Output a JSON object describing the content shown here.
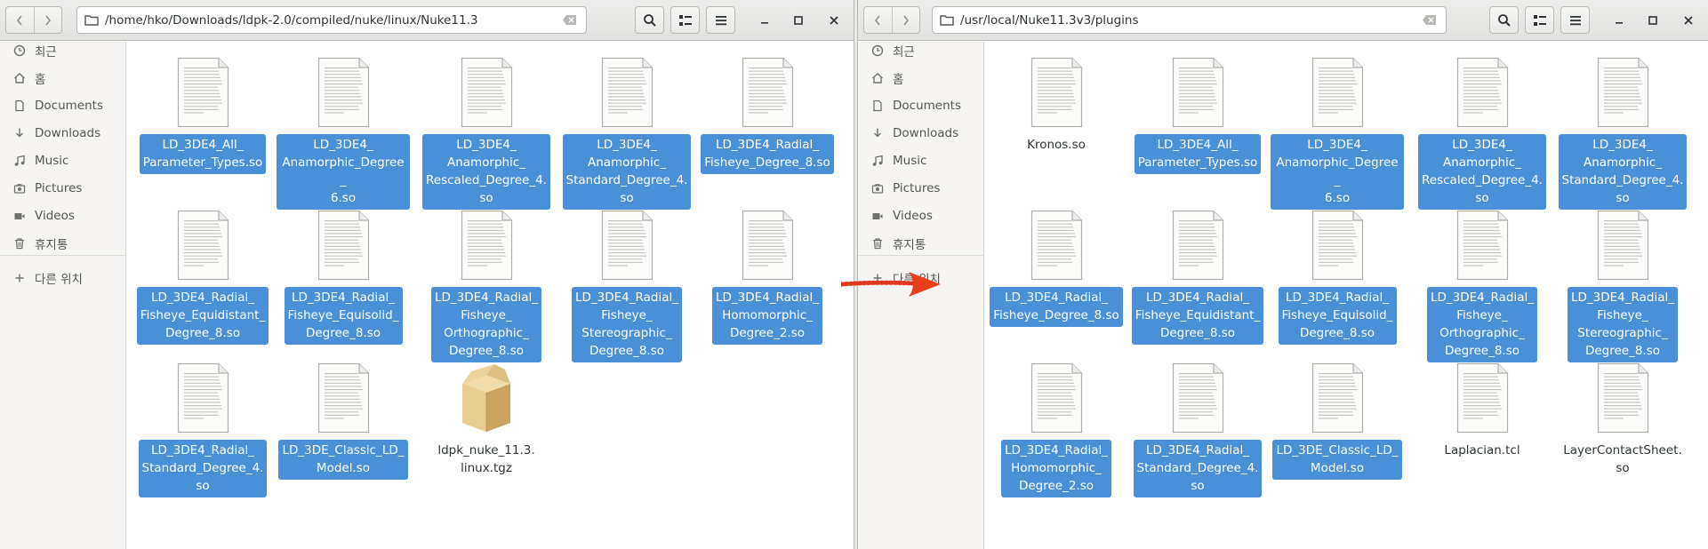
{
  "left": {
    "path": "/home/hko/Downloads/ldpk-2.0/compiled/nuke/linux/Nuke11.3",
    "files": [
      {
        "name": "LD_3DE4_All_\nParameter_Types.so",
        "selected": true,
        "icon": "document-icon"
      },
      {
        "name": "LD_3DE4_\nAnamorphic_Degree_\n6.so",
        "selected": true,
        "icon": "document-icon"
      },
      {
        "name": "LD_3DE4_\nAnamorphic_\nRescaled_Degree_4.\nso",
        "selected": true,
        "icon": "document-icon"
      },
      {
        "name": "LD_3DE4_\nAnamorphic_\nStandard_Degree_4.\nso",
        "selected": true,
        "icon": "document-icon"
      },
      {
        "name": "LD_3DE4_Radial_\nFisheye_Degree_8.so",
        "selected": true,
        "icon": "document-icon"
      },
      {
        "name": "LD_3DE4_Radial_\nFisheye_Equidistant_\nDegree_8.so",
        "selected": true,
        "icon": "document-icon"
      },
      {
        "name": "LD_3DE4_Radial_\nFisheye_Equisolid_\nDegree_8.so",
        "selected": true,
        "icon": "document-icon"
      },
      {
        "name": "LD_3DE4_Radial_\nFisheye_\nOrthographic_\nDegree_8.so",
        "selected": true,
        "icon": "document-icon"
      },
      {
        "name": "LD_3DE4_Radial_\nFisheye_\nStereographic_\nDegree_8.so",
        "selected": true,
        "icon": "document-icon"
      },
      {
        "name": "LD_3DE4_Radial_\nHomomorphic_\nDegree_2.so",
        "selected": true,
        "icon": "document-icon"
      },
      {
        "name": "LD_3DE4_Radial_\nStandard_Degree_4.\nso",
        "selected": true,
        "icon": "document-icon"
      },
      {
        "name": "LD_3DE_Classic_LD_\nModel.so",
        "selected": true,
        "icon": "document-icon"
      },
      {
        "name": "ldpk_nuke_11.3.\nlinux.tgz",
        "selected": false,
        "icon": "package-icon"
      }
    ]
  },
  "right": {
    "path": "/usr/local/Nuke11.3v3/plugins",
    "files": [
      {
        "name": "Kronos.so",
        "selected": false,
        "icon": "document-icon"
      },
      {
        "name": "LD_3DE4_All_\nParameter_Types.so",
        "selected": true,
        "icon": "document-icon"
      },
      {
        "name": "LD_3DE4_\nAnamorphic_Degree_\n6.so",
        "selected": true,
        "icon": "document-icon"
      },
      {
        "name": "LD_3DE4_\nAnamorphic_\nRescaled_Degree_4.\nso",
        "selected": true,
        "icon": "document-icon"
      },
      {
        "name": "LD_3DE4_\nAnamorphic_\nStandard_Degree_4.\nso",
        "selected": true,
        "icon": "document-icon"
      },
      {
        "name": "LD_3DE4_Radial_\nFisheye_Degree_8.so",
        "selected": true,
        "icon": "document-icon"
      },
      {
        "name": "LD_3DE4_Radial_\nFisheye_Equidistant_\nDegree_8.so",
        "selected": true,
        "icon": "document-icon"
      },
      {
        "name": "LD_3DE4_Radial_\nFisheye_Equisolid_\nDegree_8.so",
        "selected": true,
        "icon": "document-icon"
      },
      {
        "name": "LD_3DE4_Radial_\nFisheye_\nOrthographic_\nDegree_8.so",
        "selected": true,
        "icon": "document-icon"
      },
      {
        "name": "LD_3DE4_Radial_\nFisheye_\nStereographic_\nDegree_8.so",
        "selected": true,
        "icon": "document-icon"
      },
      {
        "name": "LD_3DE4_Radial_\nHomomorphic_\nDegree_2.so",
        "selected": true,
        "icon": "document-icon"
      },
      {
        "name": "LD_3DE4_Radial_\nStandard_Degree_4.\nso",
        "selected": true,
        "icon": "document-icon"
      },
      {
        "name": "LD_3DE_Classic_LD_\nModel.so",
        "selected": true,
        "icon": "document-icon"
      },
      {
        "name": "Laplacian.tcl",
        "selected": false,
        "icon": "document-icon"
      },
      {
        "name": "LayerContactSheet.\nso",
        "selected": false,
        "icon": "document-icon"
      }
    ]
  },
  "sidebar": [
    {
      "label": "최근",
      "icon": "clock-icon"
    },
    {
      "label": "홈",
      "icon": "home-icon"
    },
    {
      "label": "Documents",
      "icon": "document-folder-icon"
    },
    {
      "label": "Downloads",
      "icon": "download-icon"
    },
    {
      "label": "Music",
      "icon": "music-icon"
    },
    {
      "label": "Pictures",
      "icon": "camera-icon"
    },
    {
      "label": "Videos",
      "icon": "video-icon"
    },
    {
      "label": "휴지통",
      "icon": "trash-icon"
    },
    {
      "label": "다른 위치",
      "icon": "plus-icon"
    }
  ],
  "colors": {
    "selection": "#4a90d9",
    "arrow": "#e03a1e"
  }
}
